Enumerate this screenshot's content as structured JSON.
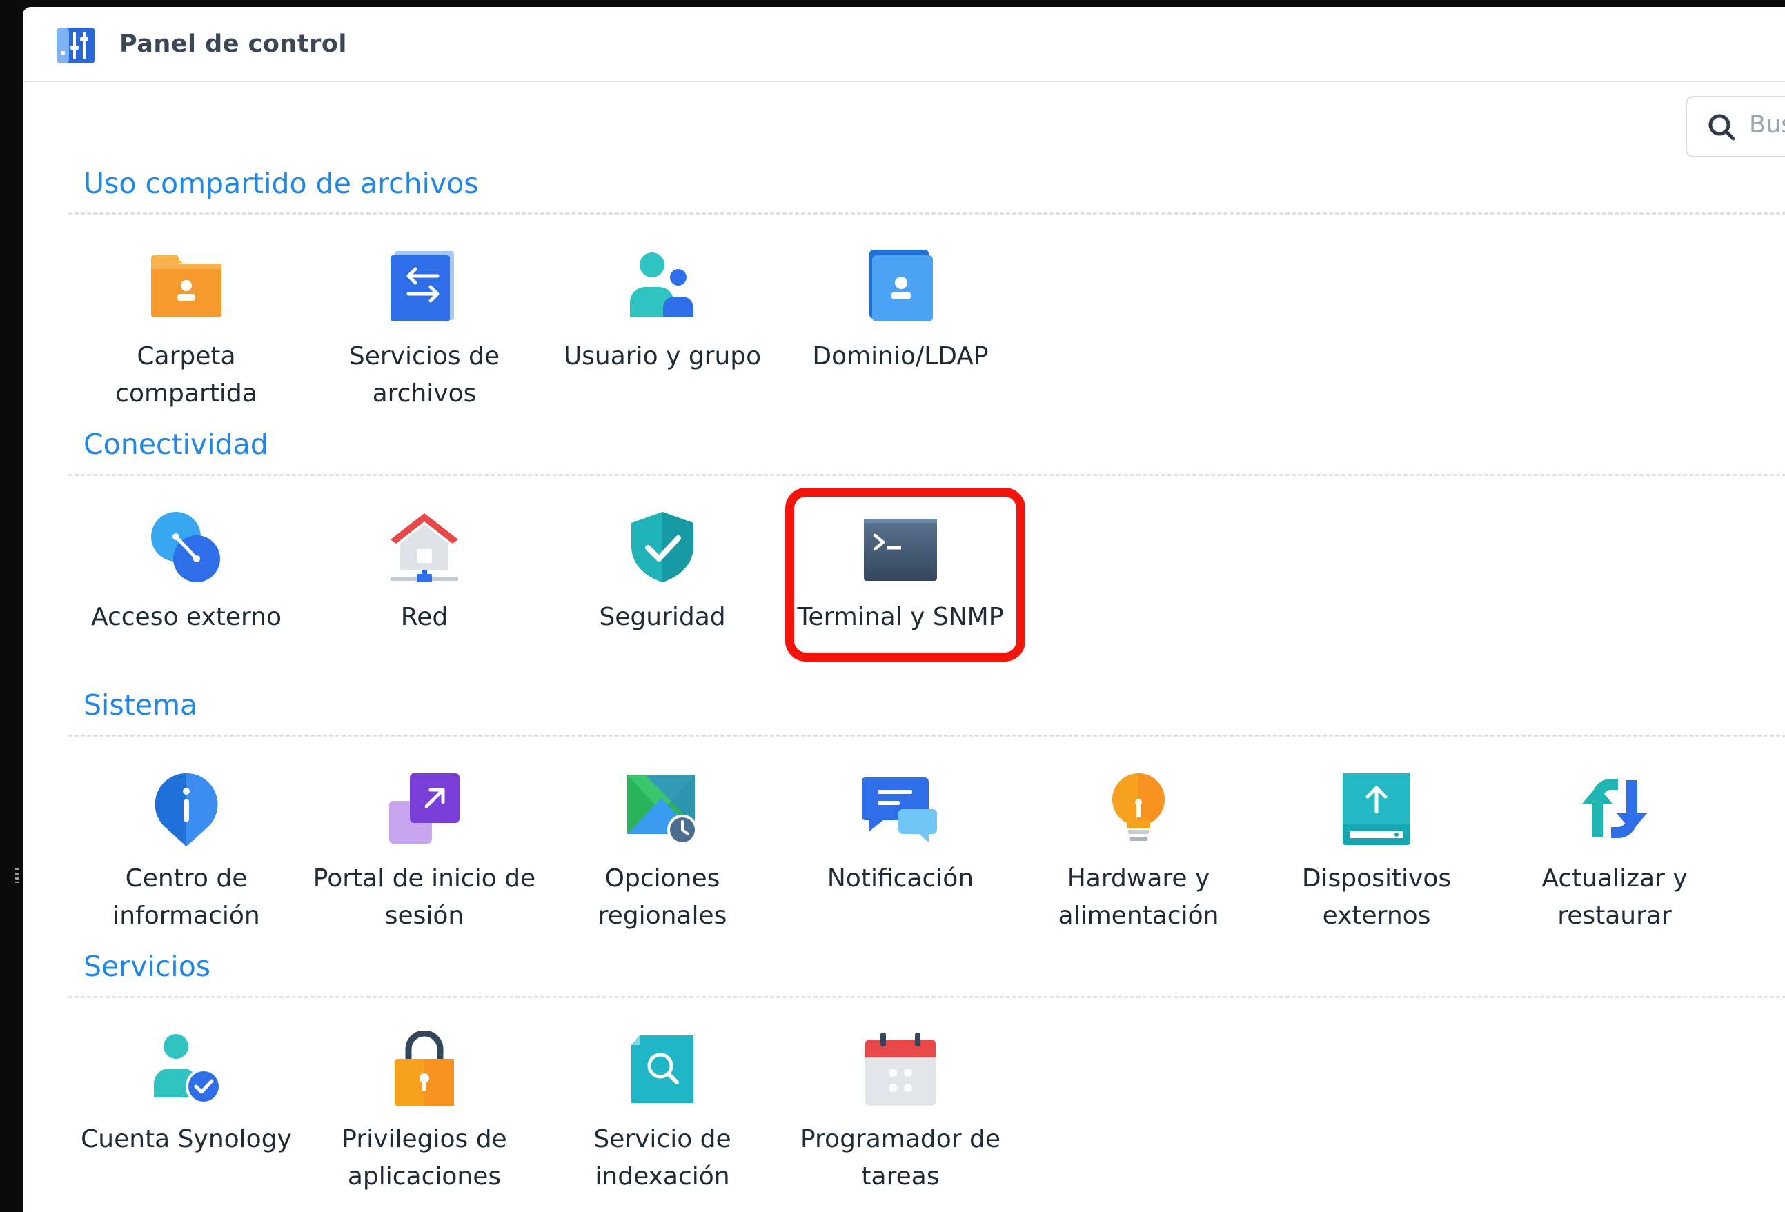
{
  "window": {
    "title": "Panel de control"
  },
  "search": {
    "placeholder": "Bus"
  },
  "sections": [
    {
      "title": "Uso compartido de archivos",
      "items": [
        {
          "label": "Carpeta compartida",
          "icon": "shared-folder-icon"
        },
        {
          "label": "Servicios de archivos",
          "icon": "file-services-icon"
        },
        {
          "label": "Usuario y grupo",
          "icon": "user-group-icon"
        },
        {
          "label": "Dominio/LDAP",
          "icon": "domain-ldap-icon"
        }
      ]
    },
    {
      "title": "Conectividad",
      "items": [
        {
          "label": "Acceso externo",
          "icon": "external-access-icon"
        },
        {
          "label": "Red",
          "icon": "network-icon"
        },
        {
          "label": "Seguridad",
          "icon": "security-shield-icon"
        },
        {
          "label": "Terminal y SNMP",
          "icon": "terminal-icon",
          "highlighted": true
        }
      ]
    },
    {
      "title": "Sistema",
      "items": [
        {
          "label": "Centro de información",
          "icon": "info-center-icon"
        },
        {
          "label": "Portal de inicio de sesión",
          "icon": "login-portal-icon"
        },
        {
          "label": "Opciones regionales",
          "icon": "regional-options-icon"
        },
        {
          "label": "Notificación",
          "icon": "notification-icon"
        },
        {
          "label": "Hardware y alimentación",
          "icon": "hardware-power-icon"
        },
        {
          "label": "Dispositivos externos",
          "icon": "external-devices-icon"
        },
        {
          "label": "Actualizar y restaurar",
          "icon": "update-restore-icon"
        }
      ]
    },
    {
      "title": "Servicios",
      "items": [
        {
          "label": "Cuenta Synology",
          "icon": "synology-account-icon"
        },
        {
          "label": "Privilegios de aplicaciones",
          "icon": "app-privileges-icon"
        },
        {
          "label": "Servicio de indexación",
          "icon": "indexing-service-icon"
        },
        {
          "label": "Programador de tareas",
          "icon": "task-scheduler-icon"
        }
      ]
    }
  ],
  "colors": {
    "section_title": "#1f87e8",
    "highlight": "#f4140c"
  }
}
